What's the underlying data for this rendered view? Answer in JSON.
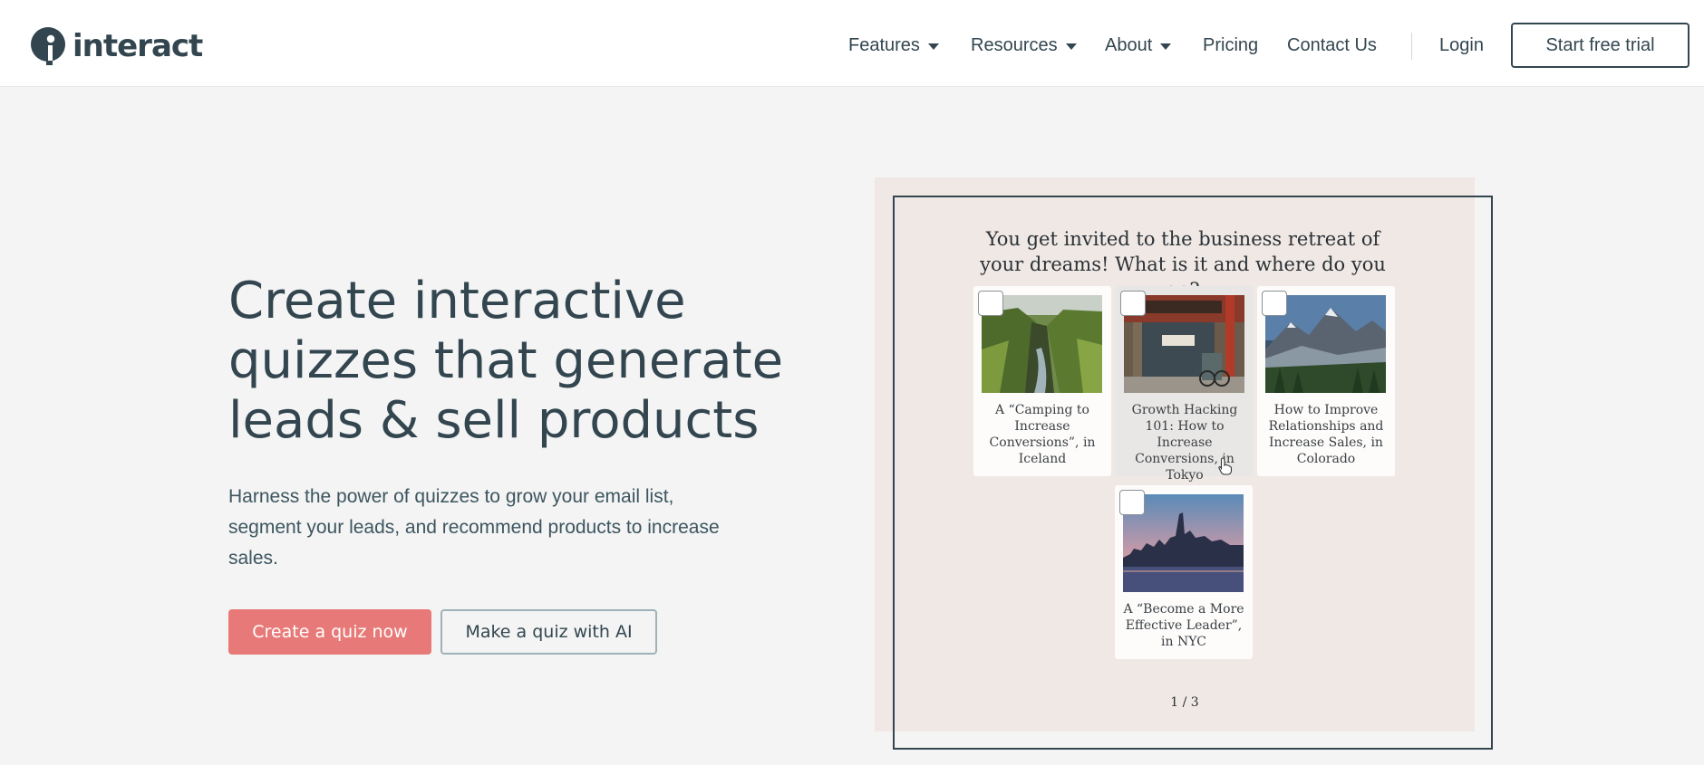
{
  "brand": {
    "name": "interact",
    "color": "#334650"
  },
  "nav": {
    "items": [
      {
        "label": "Features",
        "dropdown": true
      },
      {
        "label": "Resources",
        "dropdown": true
      },
      {
        "label": "About",
        "dropdown": true
      },
      {
        "label": "Pricing",
        "dropdown": false
      },
      {
        "label": "Contact Us",
        "dropdown": false
      }
    ],
    "login": "Login",
    "trial": "Start free trial"
  },
  "hero": {
    "title": "Create interactive quizzes that generate leads & sell products",
    "subtitle": "Harness the power of quizzes to grow your email list, segment your leads, and recommend products to increase sales.",
    "primary_cta": "Create a quiz now",
    "secondary_cta": "Make a quiz with AI",
    "primary_color": "#e77a78"
  },
  "quiz": {
    "question": "You get invited to the business retreat of your dreams! What is it and where do you go?",
    "options": [
      {
        "caption": "A “Camping to Increase Conversions”, in Iceland",
        "image": "canyon-waterfall-image"
      },
      {
        "caption": "Growth Hacking 101: How to Increase Conversions, in Tokyo",
        "image": "tokyo-storefront-image"
      },
      {
        "caption": "How to Improve Relationships and Increase Sales, in Colorado",
        "image": "mountain-range-image"
      },
      {
        "caption": "A “Become a More Effective Leader”, in NYC",
        "image": "nyc-skyline-image"
      }
    ],
    "pager": "1 / 3"
  }
}
